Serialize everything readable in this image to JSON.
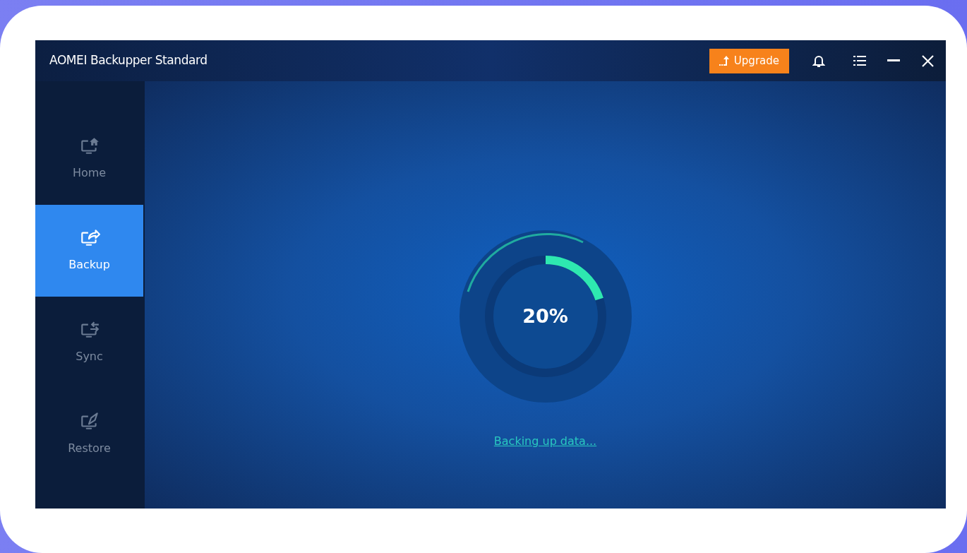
{
  "window": {
    "title": "AOMEI Backupper Standard"
  },
  "toolbar": {
    "upgrade_label": "Upgrade"
  },
  "sidebar": {
    "items": [
      {
        "label": "Home",
        "kind": "home",
        "selected": false
      },
      {
        "label": "Backup",
        "kind": "backup",
        "selected": true
      },
      {
        "label": "Sync",
        "kind": "sync",
        "selected": false
      },
      {
        "label": "Restore",
        "kind": "restore",
        "selected": false
      }
    ]
  },
  "progress": {
    "level": 0.2,
    "reading": "20%",
    "status_link": "Backing up data..."
  }
}
